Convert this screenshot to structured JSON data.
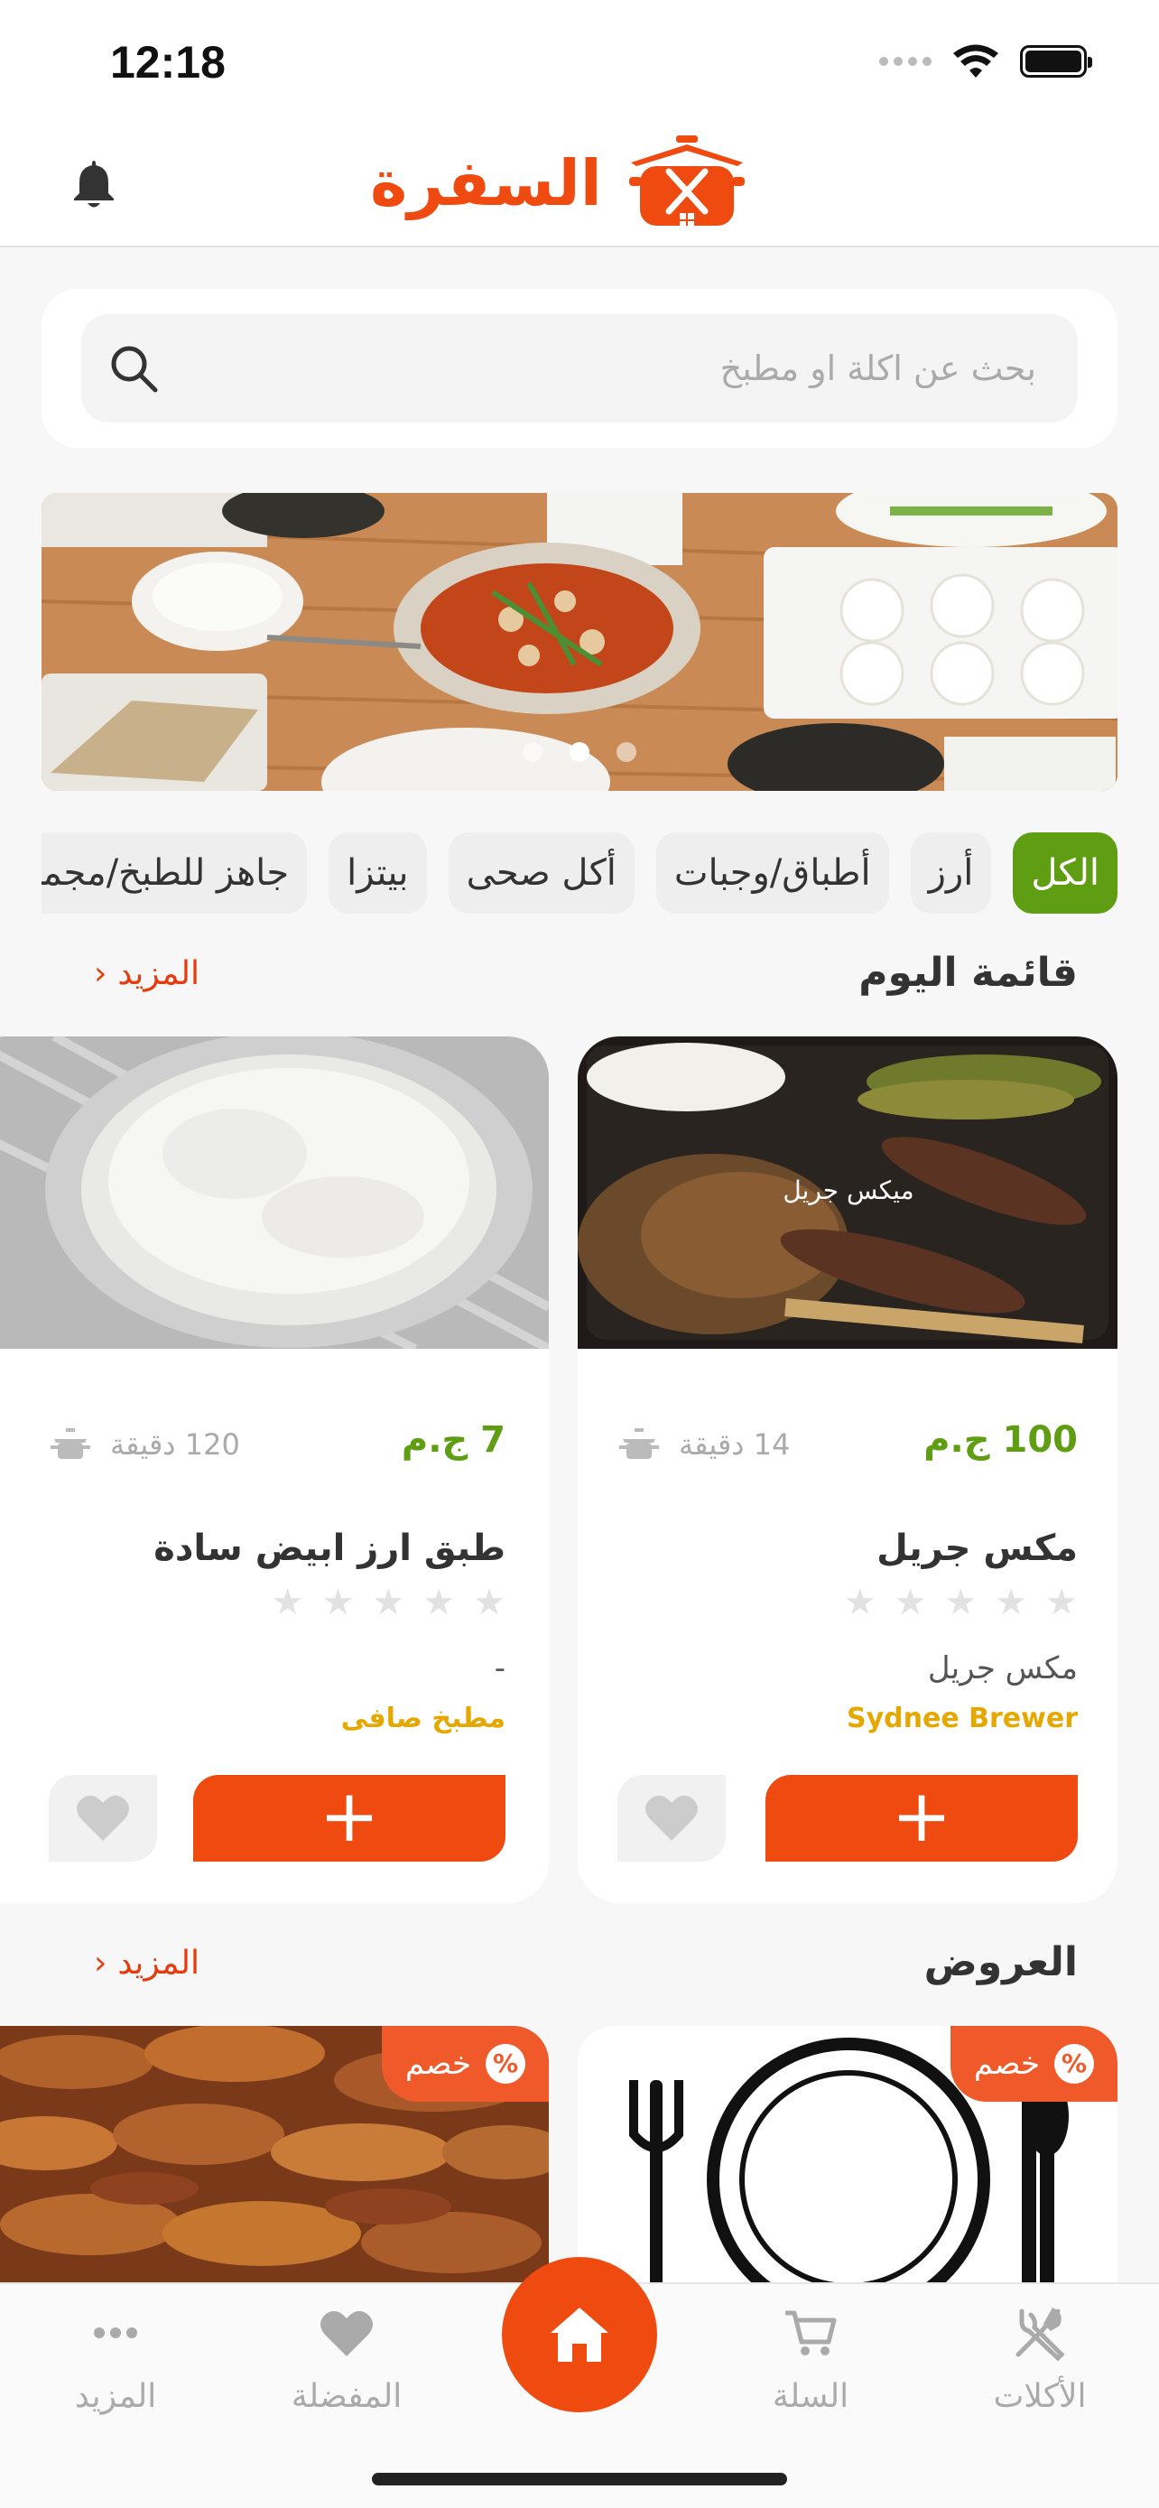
{
  "status": {
    "time": "12:18"
  },
  "header": {
    "logo_text": "السفرة"
  },
  "search": {
    "placeholder": "بحث عن اكلة او مطبخ"
  },
  "banner": {
    "slide_count": 3,
    "active_slide": 2
  },
  "categories": [
    {
      "label": "الكل",
      "active": true
    },
    {
      "label": "أرز",
      "active": false
    },
    {
      "label": "أطباق/وجبات",
      "active": false
    },
    {
      "label": "أكل صحى",
      "active": false
    },
    {
      "label": "بيتزا",
      "active": false
    },
    {
      "label": "جاهز للطبخ/مجمد",
      "active": false
    }
  ],
  "todays_menu": {
    "title": "قائمة اليوم",
    "more_label": "المزيد",
    "items": [
      {
        "photo_caption": "ميكس جريل",
        "price": "100 ج.م",
        "prep_time": "14 دقيقة",
        "name": "مكس جريل",
        "rating": 0,
        "description": "مكس جريل",
        "kitchen": "Sydnee Brewer"
      },
      {
        "photo_caption": "",
        "price": "7 ج.م",
        "prep_time": "120 دقيقة",
        "name": "طبق ارز ابيض سادة",
        "rating": 0,
        "description": "-",
        "kitchen": "مطبخ صافى"
      }
    ]
  },
  "offers": {
    "title": "العروض",
    "more_label": "المزيد",
    "badge_label": "خصم",
    "badge_symbol": "%"
  },
  "bottom_nav": {
    "items": [
      {
        "label": "الأكلات",
        "icon": "fork-knife-icon"
      },
      {
        "label": "السلة",
        "icon": "cart-icon"
      },
      {
        "label": "",
        "icon": "home-icon"
      },
      {
        "label": "المفضلة",
        "icon": "heart-icon"
      },
      {
        "label": "المزيد",
        "icon": "more-dots-icon"
      }
    ]
  },
  "colors": {
    "brand_orange": "#ef4b10",
    "price_green": "#5f9e12",
    "kitchen_gold": "#e6a800"
  }
}
